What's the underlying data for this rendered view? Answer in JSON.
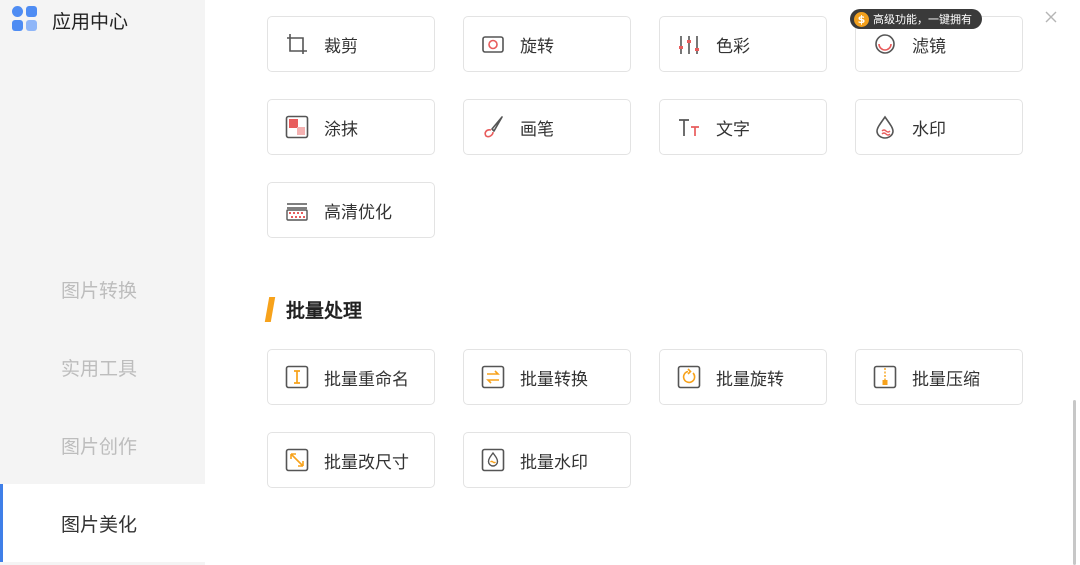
{
  "app": {
    "title": "应用中心"
  },
  "sidebar": {
    "items": [
      {
        "label": "图片转换",
        "active": false
      },
      {
        "label": "实用工具",
        "active": false
      },
      {
        "label": "图片创作",
        "active": false
      },
      {
        "label": "图片美化",
        "active": true
      }
    ]
  },
  "badge": {
    "text": "高级功能，一键拥有",
    "coin_symbol": "$"
  },
  "beautify_tools": [
    {
      "label": "裁剪",
      "icon": "crop-icon"
    },
    {
      "label": "旋转",
      "icon": "rotate-icon"
    },
    {
      "label": "色彩",
      "icon": "color-adjust-icon"
    },
    {
      "label": "滤镜",
      "icon": "filter-icon"
    },
    {
      "label": "涂抹",
      "icon": "mosaic-icon"
    },
    {
      "label": "画笔",
      "icon": "brush-icon"
    },
    {
      "label": "文字",
      "icon": "text-icon"
    },
    {
      "label": "水印",
      "icon": "watermark-icon"
    },
    {
      "label": "高清优化",
      "icon": "hd-enhance-icon"
    }
  ],
  "batch_section": {
    "title": "批量处理"
  },
  "batch_tools": [
    {
      "label": "批量重命名",
      "icon": "batch-rename-icon"
    },
    {
      "label": "批量转换",
      "icon": "batch-convert-icon"
    },
    {
      "label": "批量旋转",
      "icon": "batch-rotate-icon"
    },
    {
      "label": "批量压缩",
      "icon": "batch-compress-icon"
    },
    {
      "label": "批量改尺寸",
      "icon": "batch-resize-icon"
    },
    {
      "label": "批量水印",
      "icon": "batch-watermark-icon"
    }
  ],
  "colors": {
    "accent_orange": "#f7a21b",
    "accent_blue": "#3f7fe8",
    "icon_red": "#e85c5c"
  }
}
